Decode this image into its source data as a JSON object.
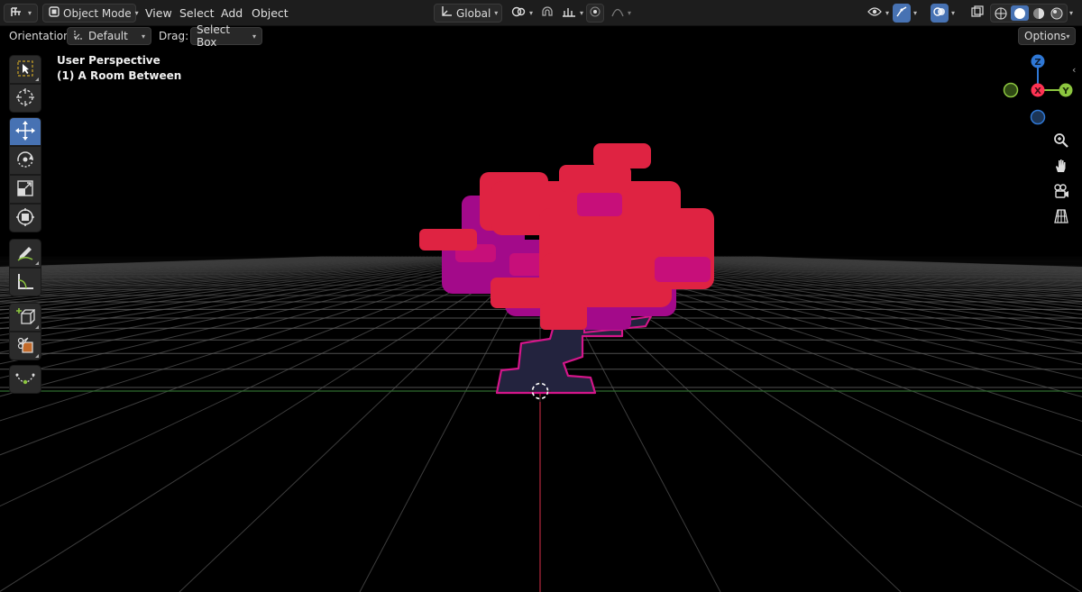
{
  "header": {
    "mode": "Object Mode",
    "menus": [
      "View",
      "Select",
      "Add",
      "Object"
    ],
    "transform_orientation": "Global"
  },
  "tool_settings": {
    "orientation_label": "Orientation:",
    "orientation_value": "Default",
    "drag_label": "Drag:",
    "drag_value": "Select Box",
    "options_label": "Options"
  },
  "viewport": {
    "perspective": "User Perspective",
    "collection": "(1) A Room Between"
  },
  "gizmo": {
    "z": "Z",
    "x": "X",
    "y": "Y"
  },
  "left_tools": [
    "select-box",
    "cursor",
    "move",
    "rotate",
    "scale",
    "transform",
    "annotate",
    "measure",
    "add-cube",
    "extrude",
    "curve"
  ],
  "colors": {
    "header_bg": "#1d1d1d",
    "active_blue": "#4772b3",
    "foliage_red": "#df2342",
    "foliage_magenta": "#a30a8a",
    "foliage_pink": "#c70f7a",
    "trunk": "#23233e",
    "outline": "#d4168a",
    "axis_x": "#ff3353",
    "axis_y": "#8cc63f",
    "axis_z": "#2f78d6"
  }
}
